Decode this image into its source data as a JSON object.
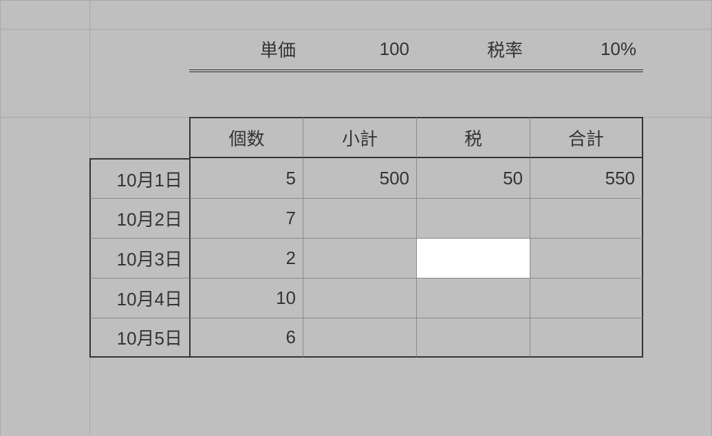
{
  "header": {
    "unit_price_label": "単価",
    "unit_price_value": "100",
    "tax_rate_label": "税率",
    "tax_rate_value": "10%"
  },
  "columns": {
    "quantity": "個数",
    "subtotal": "小計",
    "tax": "税",
    "total": "合計"
  },
  "rows": [
    {
      "date": "10月1日",
      "quantity": "5",
      "subtotal": "500",
      "tax": "50",
      "total": "550"
    },
    {
      "date": "10月2日",
      "quantity": "7",
      "subtotal": "",
      "tax": "",
      "total": ""
    },
    {
      "date": "10月3日",
      "quantity": "2",
      "subtotal": "",
      "tax": "",
      "total": ""
    },
    {
      "date": "10月4日",
      "quantity": "10",
      "subtotal": "",
      "tax": "",
      "total": ""
    },
    {
      "date": "10月5日",
      "quantity": "6",
      "subtotal": "",
      "tax": "",
      "total": ""
    }
  ],
  "selected_cell": {
    "row_index": 2,
    "column": "tax"
  }
}
